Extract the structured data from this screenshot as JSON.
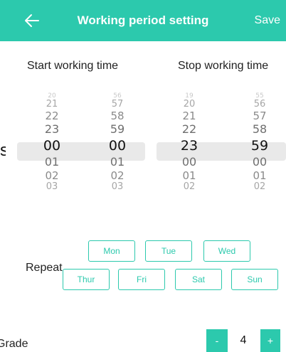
{
  "header": {
    "title": "Working period setting",
    "save_label": "Save",
    "bg_color": "#2cc9ad"
  },
  "start": {
    "label": "Start working time",
    "hour": [
      "20",
      "21",
      "22",
      "23",
      "00",
      "01",
      "02",
      "03"
    ],
    "minute": [
      "56",
      "57",
      "58",
      "59",
      "00",
      "01",
      "02",
      "03"
    ],
    "selected_hour": "00",
    "selected_minute": "00"
  },
  "stop": {
    "label": "Stop working time",
    "hour": [
      "19",
      "20",
      "21",
      "22",
      "23",
      "00",
      "01",
      "02"
    ],
    "minute": [
      "55",
      "56",
      "57",
      "58",
      "59",
      "00",
      "01",
      "02"
    ],
    "selected_hour": "23",
    "selected_minute": "59"
  },
  "repeat": {
    "label": "Repeat",
    "days": [
      "Mon",
      "Tue",
      "Wed",
      "Thur",
      "Fri",
      "Sat",
      "Sun"
    ]
  },
  "grade": {
    "label": "Grade",
    "value": "4",
    "minus_label": "-",
    "plus_label": "+"
  },
  "left_edge_glyph": "s."
}
